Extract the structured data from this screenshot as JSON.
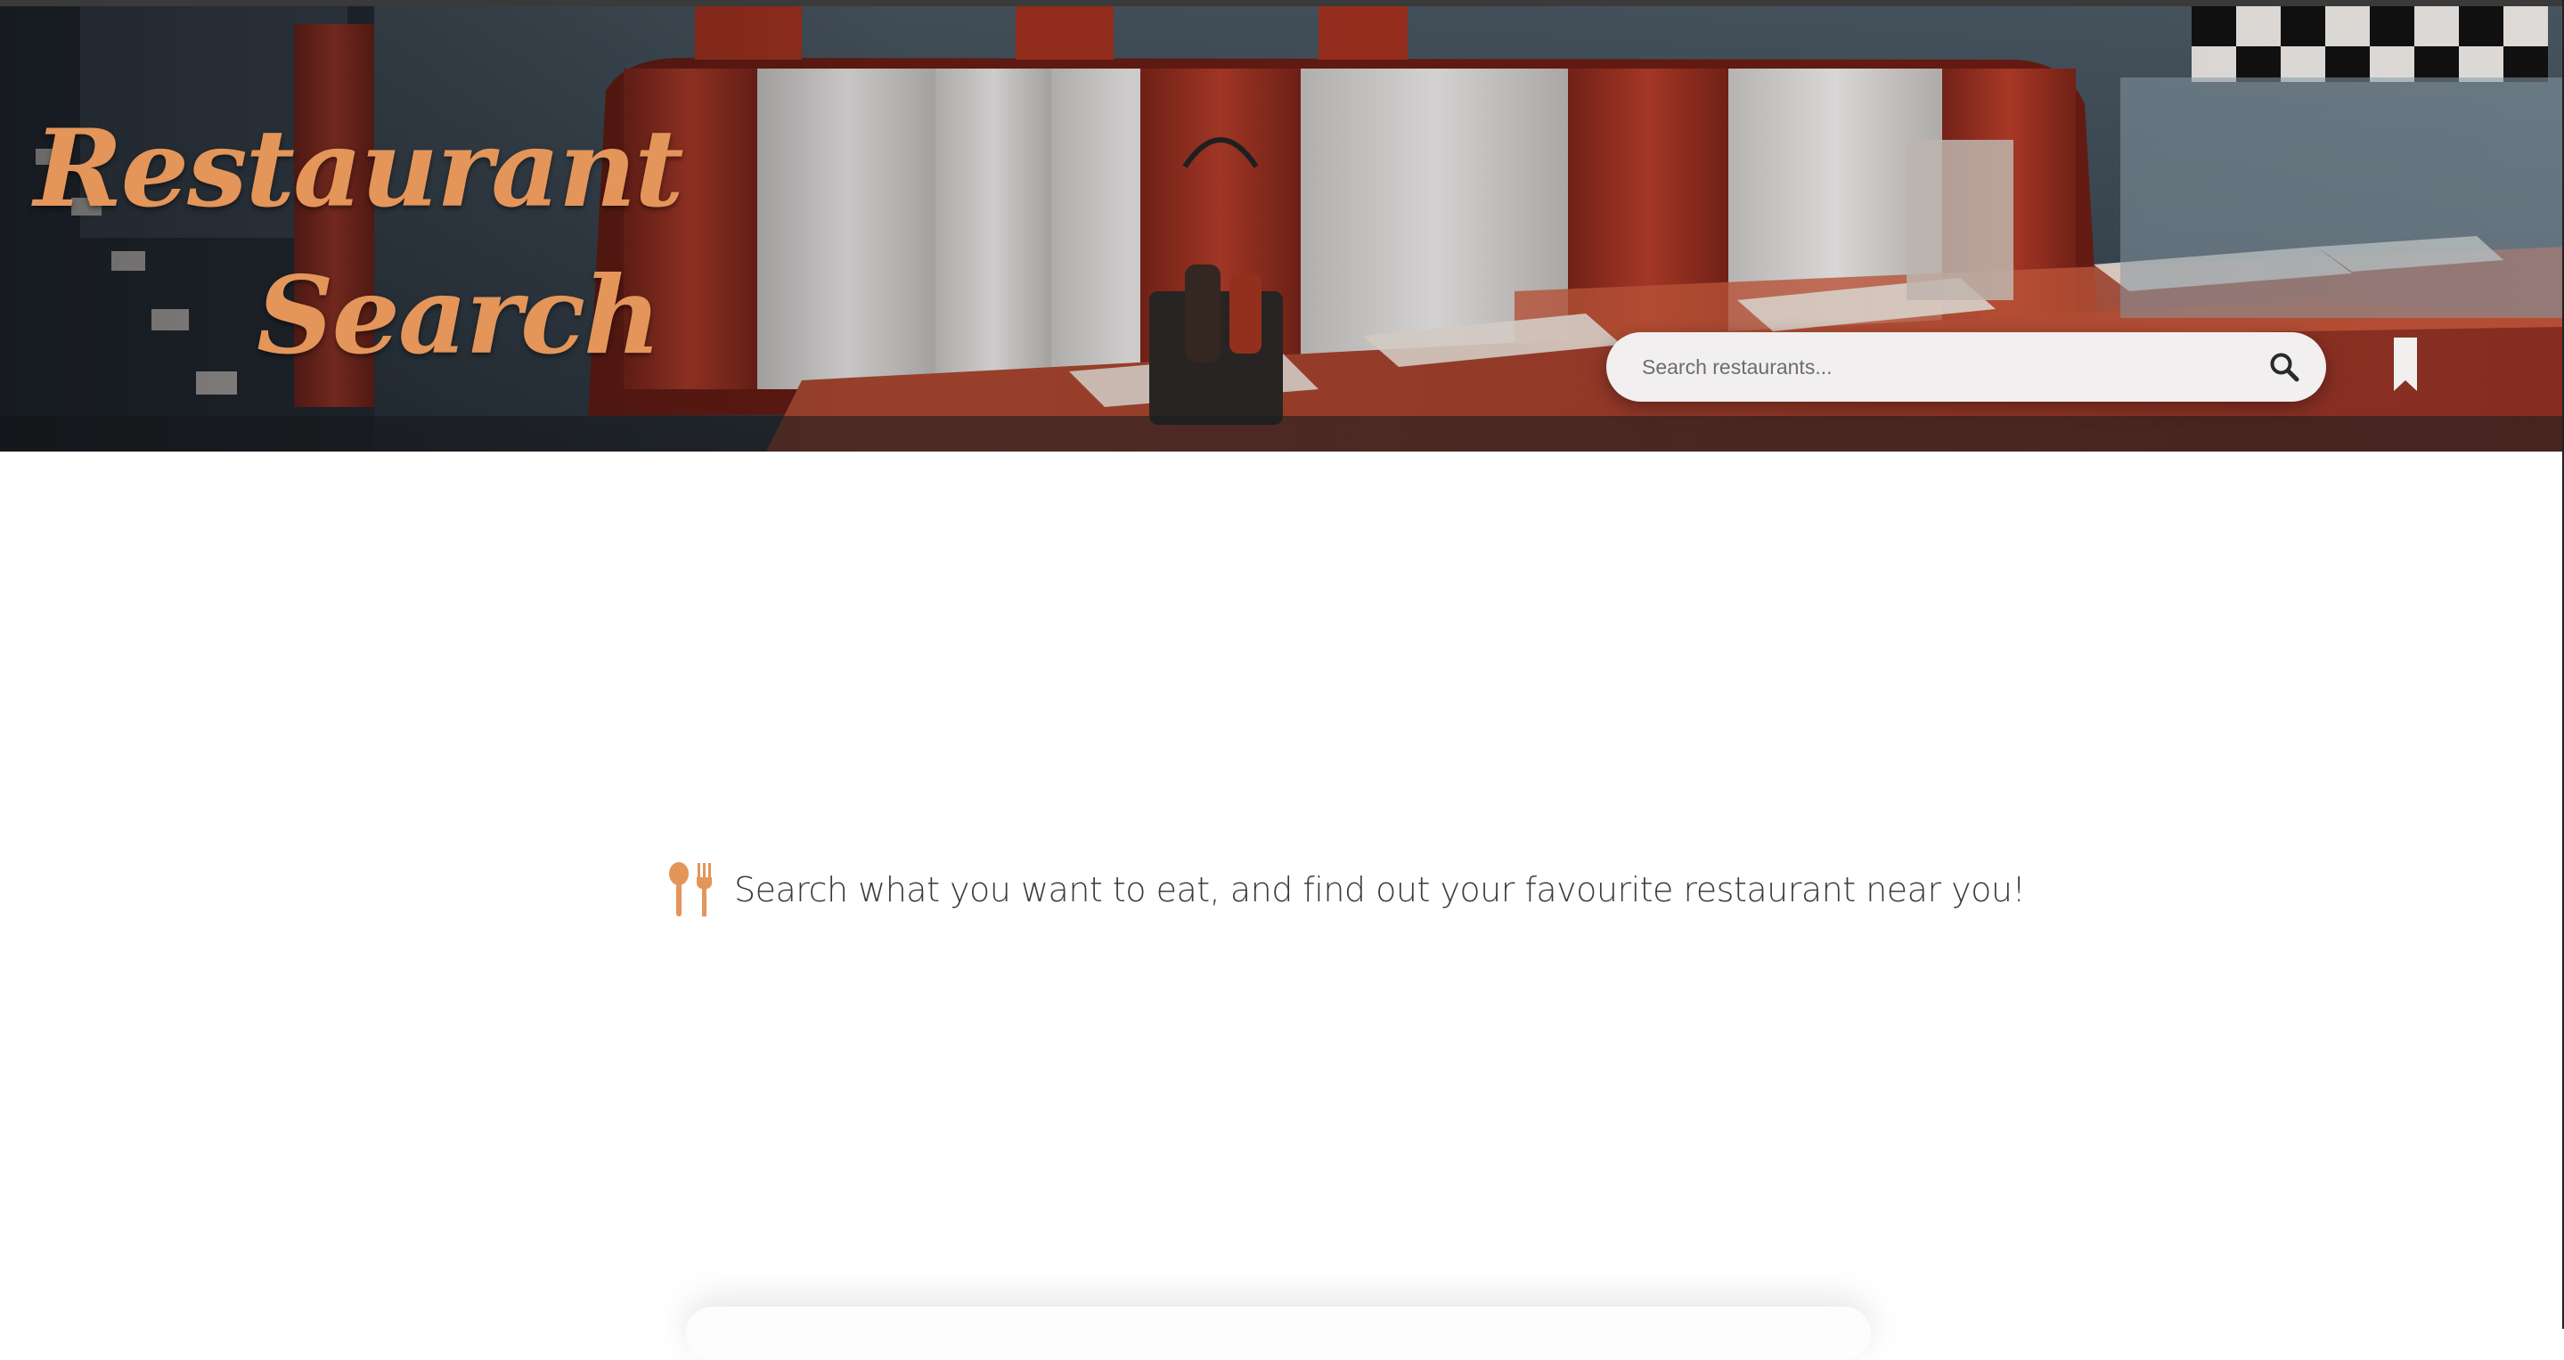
{
  "header": {
    "logo_line1": "Restaurant",
    "logo_line2": "Search",
    "logo_color": "#e3955a"
  },
  "search": {
    "placeholder": "Search restaurants...",
    "value": "",
    "icon": "search-icon"
  },
  "bookmark": {
    "icon": "bookmark-icon"
  },
  "main": {
    "message": "Search what you want to eat, and find out your favourite restaurant near you!",
    "message_icon": "utensils-icon",
    "accent_color": "#e3955a"
  }
}
